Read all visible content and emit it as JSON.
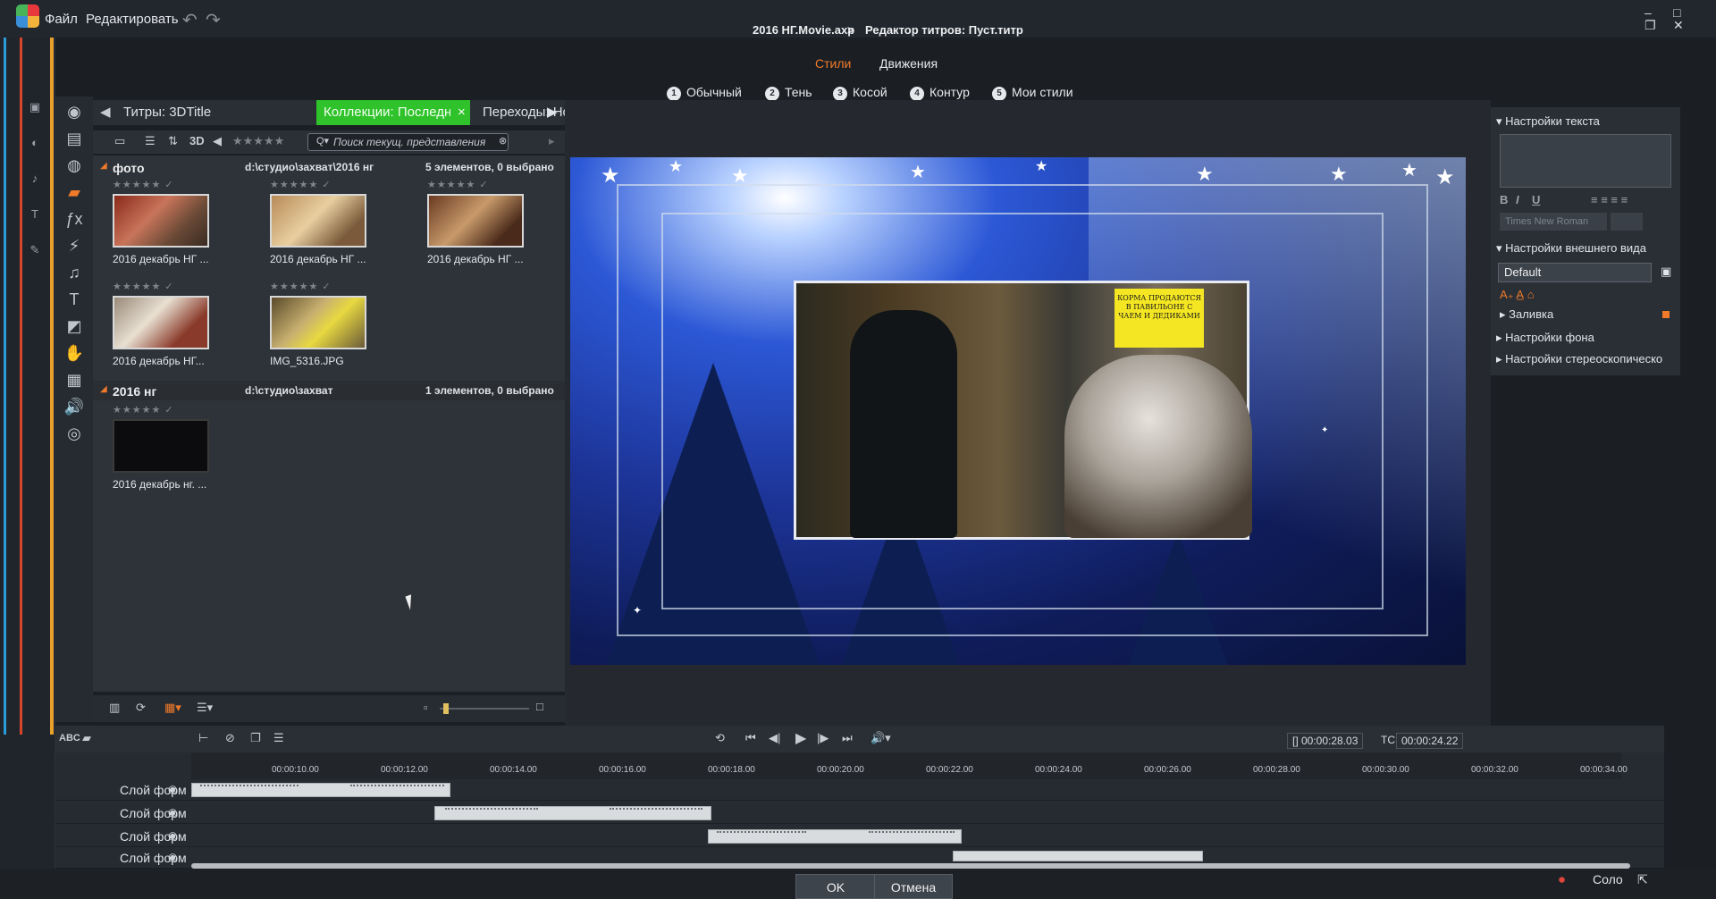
{
  "menubar": {
    "file": "Файл",
    "edit": "Редактировать"
  },
  "window": {
    "project": "2016 НГ.Movie.axp",
    "sep": ">",
    "editor": "Редактор титров: Пуст.титр"
  },
  "modes": {
    "styles": "Стили",
    "motions": "Движения",
    "active_color": "#f07a2a"
  },
  "style_tabs": [
    {
      "num": "1",
      "label": "Обычный"
    },
    {
      "num": "2",
      "label": "Тень"
    },
    {
      "num": "3",
      "label": "Косой"
    },
    {
      "num": "4",
      "label": "Контур"
    },
    {
      "num": "5",
      "label": "Мои стили"
    }
  ],
  "library": {
    "tabs": [
      {
        "label": "Титры: 3DTitle"
      },
      {
        "label": "Коллекции: Последн...",
        "close": "×"
      },
      {
        "label": "Переходы: Hollywo"
      }
    ],
    "toolbar_3d": "3D",
    "search_placeholder": "Поиск текущ. представления",
    "groups": [
      {
        "name": "фото",
        "path": "d:\\студио\\захват\\2016 нг",
        "count": "5 элементов, 0 выбрано",
        "items": [
          {
            "label": "2016 декабрь НГ ..."
          },
          {
            "label": "2016 декабрь НГ ..."
          },
          {
            "label": "2016 декабрь НГ ..."
          },
          {
            "label": "2016 декабрь НГ..."
          },
          {
            "label": "IMG_5316.JPG"
          }
        ]
      },
      {
        "name": "2016 нг",
        "path": "d:\\студио\\захват",
        "count": "1 элементов, 0 выбрано",
        "items": [
          {
            "label": "2016 декабрь нг. ..."
          }
        ]
      }
    ]
  },
  "preview": {
    "notice_text": "КОРМА ПРОДАЮТСЯ В ПАВИЛЬОНЕ С ЧАЕМ И ДЕДИКАМИ"
  },
  "right_panel": {
    "text_settings": "Настройки текста",
    "bold": "B",
    "italic": "I",
    "underline": "U",
    "font": "Times New Roman",
    "appearance": "Настройки внешнего вида",
    "preset": "Default",
    "fill": "Заливка",
    "background": "Настройки фона",
    "stereo": "Настройки стереоскопическо"
  },
  "timeline": {
    "abc": "ABC",
    "timecode_duration": "[] 00:00:28.03",
    "timecode_tc_label": "TC",
    "timecode_current": "00:00:24.22",
    "ticks": [
      "00:00:10.00",
      "00:00:12.00",
      "00:00:14.00",
      "00:00:16.00",
      "00:00:18.00",
      "00:00:20.00",
      "00:00:22.00",
      "00:00:24.00",
      "00:00:26.00",
      "00:00:28.00",
      "00:00:30.00",
      "00:00:32.00",
      "00:00:34.00"
    ],
    "tracks": [
      {
        "label": "Слой форм"
      },
      {
        "label": "Слой форм"
      },
      {
        "label": "Слой форм"
      },
      {
        "label": "Слой форм"
      }
    ]
  },
  "buttons": {
    "ok": "OK",
    "cancel": "Отмена",
    "solo": "Соло"
  }
}
